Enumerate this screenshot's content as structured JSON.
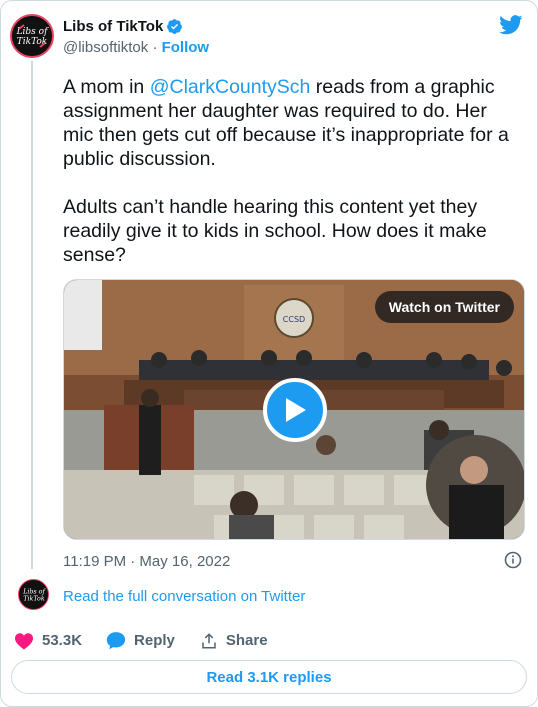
{
  "author": {
    "name": "Libs of TikTok",
    "handle": "@libsoftiktok",
    "separator": "·",
    "follow_label": "Follow",
    "avatar_text_top": "Libs of",
    "avatar_text_bottom": "TikTok"
  },
  "tweet": {
    "para1_prefix": "A mom in ",
    "para1_mention": "@ClarkCountySch",
    "para1_suffix": " reads from a graphic assignment her daughter was required to do. Her mic then gets cut off because it’s inappropriate for a public discussion.",
    "para2": "Adults can’t handle hearing this content yet they readily give it to kids in school. How does it make sense?"
  },
  "media": {
    "watch_label": "Watch on Twitter",
    "seal_text": "CCSD"
  },
  "meta": {
    "timestamp": "11:19 PM · May 16, 2022"
  },
  "conversation": {
    "read_full_label": "Read the full conversation on Twitter"
  },
  "actions": {
    "likes": "53.3K",
    "reply_label": "Reply",
    "share_label": "Share"
  },
  "replies": {
    "read_label": "Read 3.1K replies"
  },
  "colors": {
    "accent": "#1d9bf0",
    "like": "#f91880",
    "avatar_ring": "#e8435f"
  }
}
